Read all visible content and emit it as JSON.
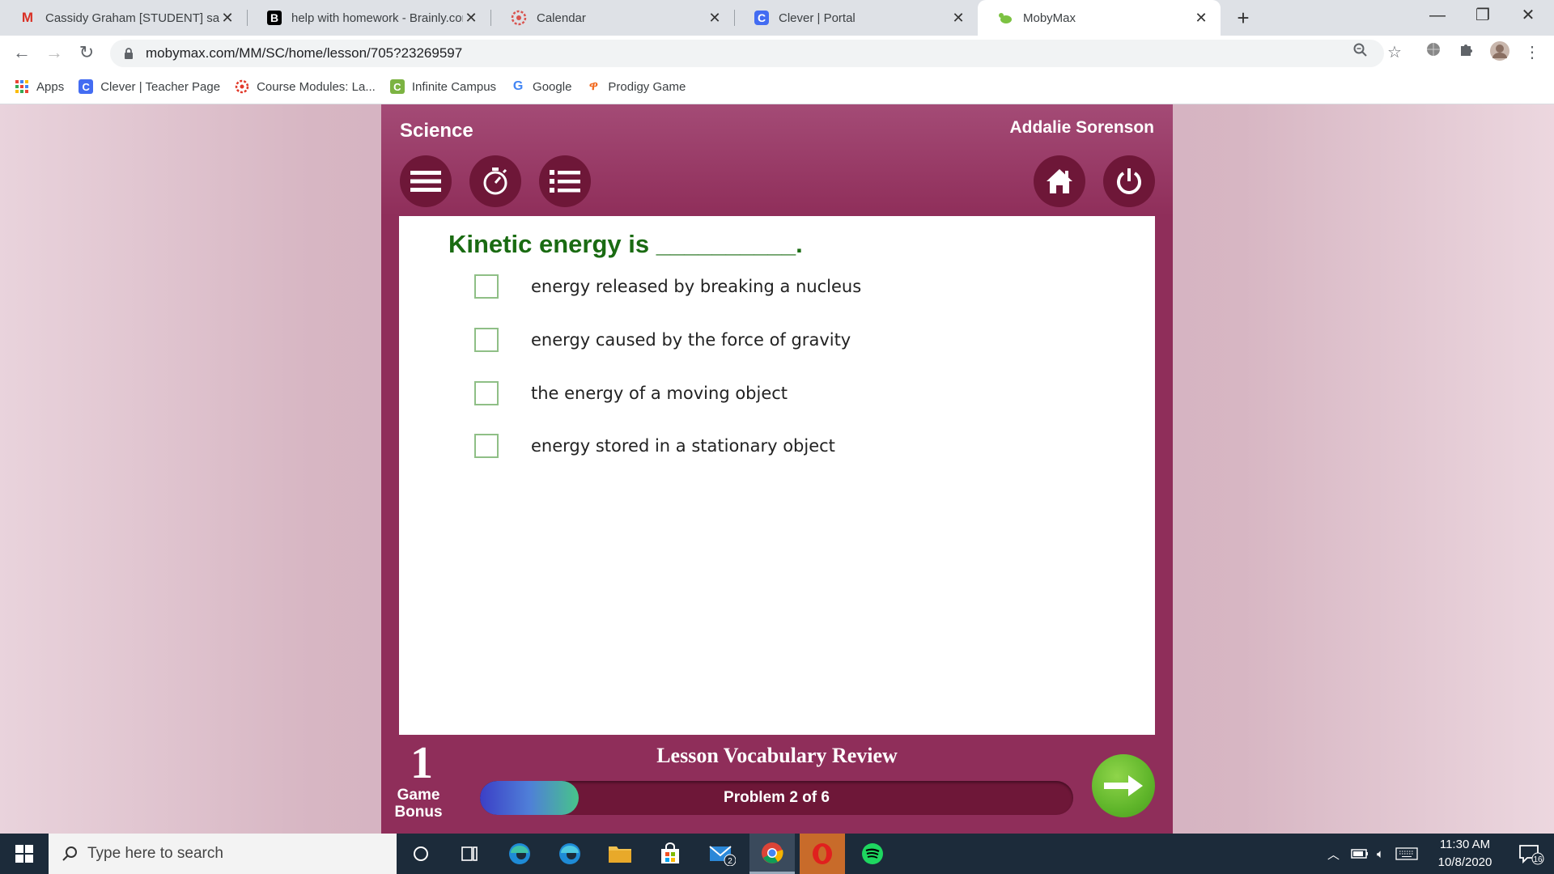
{
  "browser": {
    "tabs": [
      {
        "title": "Cassidy Graham [STUDENT] says...",
        "icon": "gmail-icon",
        "active": false
      },
      {
        "title": "help with homework - Brainly.com",
        "icon": "brainly-icon",
        "active": false
      },
      {
        "title": "Calendar",
        "icon": "calendar-icon",
        "active": false
      },
      {
        "title": "Clever | Portal",
        "icon": "clever-icon",
        "active": false
      },
      {
        "title": "MobyMax",
        "icon": "mobymax-icon",
        "active": true
      }
    ],
    "url": "mobymax.com/MM/SC/home/lesson/705?23269597",
    "bookmarks": [
      {
        "label": "Apps",
        "icon": "apps-grid-icon"
      },
      {
        "label": "Clever | Teacher Page",
        "icon": "clever-icon"
      },
      {
        "label": "Course Modules: La...",
        "icon": "canvas-icon"
      },
      {
        "label": "Infinite Campus",
        "icon": "infinite-campus-icon"
      },
      {
        "label": "Google",
        "icon": "google-icon"
      },
      {
        "label": "Prodigy Game",
        "icon": "prodigy-icon"
      }
    ]
  },
  "app": {
    "subject": "Science",
    "student_name": "Addalie Sorenson",
    "toolbar_buttons": [
      "menu-icon",
      "timer-icon",
      "list-icon",
      "home-icon",
      "power-icon"
    ],
    "question": "Kinetic energy is __________.",
    "choices": [
      {
        "text": "energy released by breaking a nucleus",
        "checked": false
      },
      {
        "text": "energy caused by the force of gravity",
        "checked": false
      },
      {
        "text": "the energy of a moving object",
        "checked": false
      },
      {
        "text": "energy stored in a stationary object",
        "checked": false
      }
    ],
    "game_bonus": {
      "count": "1",
      "label_line1": "Game",
      "label_line2": "Bonus"
    },
    "lesson_title": "Lesson Vocabulary Review",
    "progress": {
      "text": "Problem 2 of 6",
      "fraction": 0.167
    },
    "colors": {
      "panel": "#8f2e5a",
      "button": "#6e1738",
      "question": "#1a6b12",
      "next": "#5fb52a"
    }
  },
  "taskbar": {
    "search_placeholder": "Type here to search",
    "mail_badge": "2",
    "time": "11:30 AM",
    "date": "10/8/2020",
    "notification_count": "16"
  }
}
